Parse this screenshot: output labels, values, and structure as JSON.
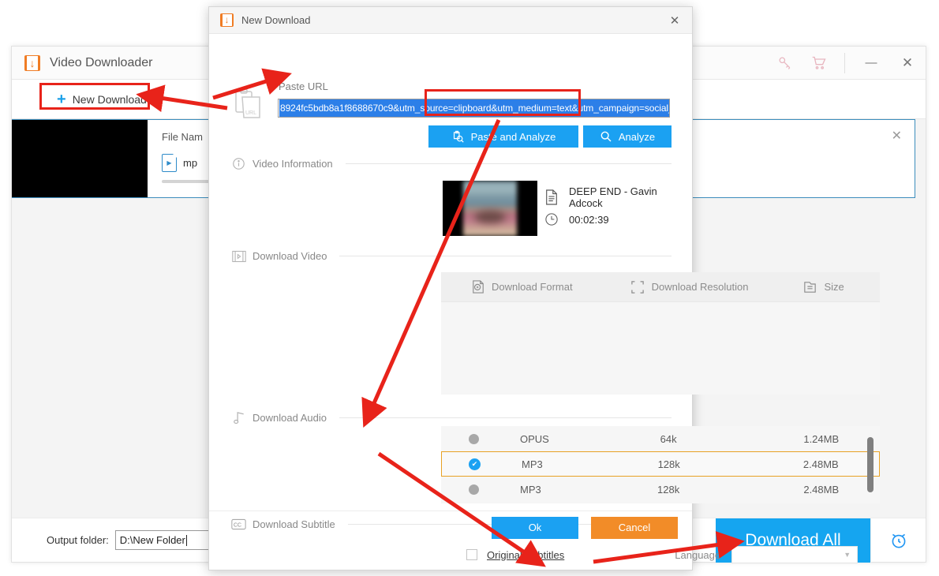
{
  "app": {
    "title": "Video Downloader",
    "logo_icon": "downloader-logo-icon",
    "titlebar_icons": [
      {
        "name": "key-icon",
        "glyph": "⚿"
      },
      {
        "name": "cart-icon",
        "glyph": "🛒"
      }
    ],
    "window_controls": {
      "minimize": "—",
      "close": "✕"
    },
    "toolbar": {
      "new_download_label": "New Download",
      "plus_glyph": "+"
    },
    "download_card": {
      "file_name_label": "File Nam",
      "file_type_text": "mp",
      "close_glyph": "✕"
    },
    "footer": {
      "output_folder_label": "Output folder:",
      "output_folder_value": "D:\\New Folder",
      "download_all_label": "Download All",
      "alarm_icon": "alarm-clock-icon"
    }
  },
  "dialog": {
    "title": "New Download",
    "close_glyph": "✕",
    "url": {
      "label": "Paste URL",
      "value": "8924fc5bdb8a1f8688670c9&utm_source=clipboard&utm_medium=text&utm_campaign=social_sharing",
      "selected": true
    },
    "buttons": {
      "paste_and_analyze": "Paste and Analyze",
      "analyze": "Analyze",
      "ok": "Ok",
      "cancel": "Cancel"
    },
    "video_information": {
      "section_label": "Video Information",
      "title": "DEEP END - Gavin Adcock",
      "duration": "00:02:39"
    },
    "download_video": {
      "section_label": "Download Video",
      "columns": [
        "Download Format",
        "Download Resolution",
        "Size"
      ],
      "rows": []
    },
    "download_audio": {
      "section_label": "Download Audio",
      "rows": [
        {
          "selected": false,
          "format": "OPUS",
          "bitrate": "64k",
          "size": "1.24MB"
        },
        {
          "selected": true,
          "format": "MP3",
          "bitrate": "128k",
          "size": "2.48MB"
        },
        {
          "selected": false,
          "format": "MP3",
          "bitrate": "128k",
          "size": "2.48MB"
        }
      ]
    },
    "download_subtitle": {
      "section_label": "Download Subtitle",
      "original_subtitles_label": "Original Subtitles",
      "original_subtitles_checked": false,
      "language_label": "Language",
      "language_value": ""
    }
  },
  "annotations": {
    "highlight_color": "#e8231a",
    "boxes": [
      {
        "name": "new-download-highlight"
      },
      {
        "name": "paste-and-analyze-highlight"
      }
    ]
  },
  "colors": {
    "accent_blue": "#1ba1f2",
    "orange": "#f28c28",
    "brand_orange": "#f07c24",
    "selection_blue": "#2c7fe8",
    "selected_row_border": "#e8a225",
    "annotation_red": "#e8231a"
  }
}
